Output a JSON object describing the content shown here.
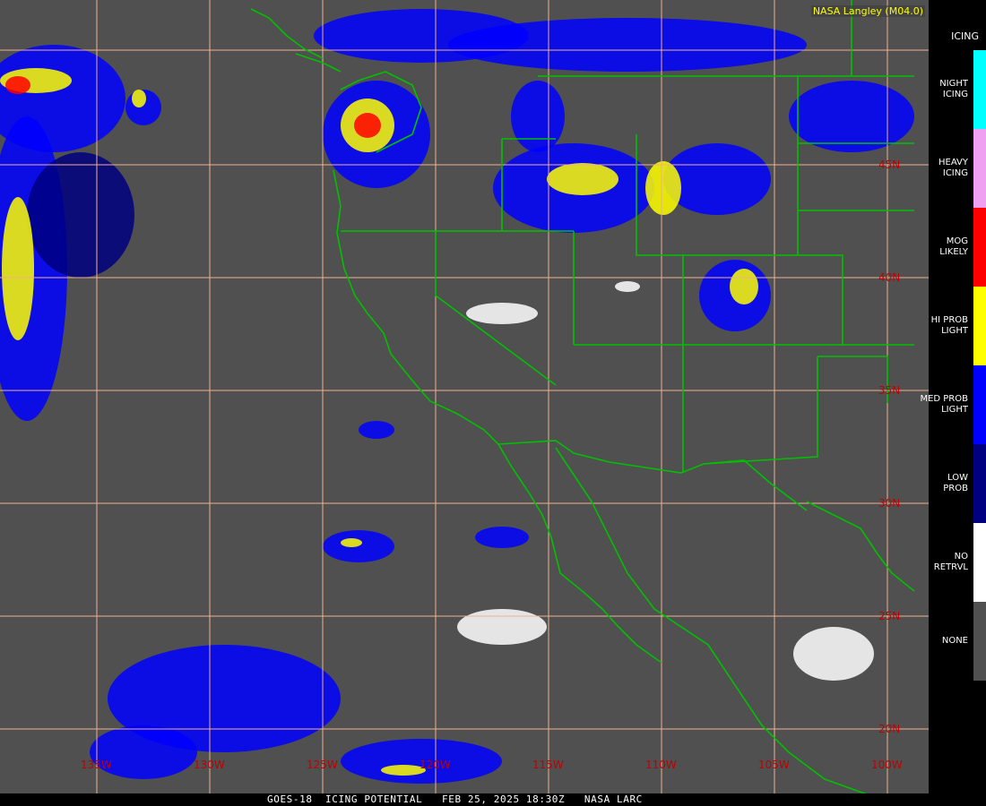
{
  "credit": "NASA Langley (M04.0)",
  "footer": "GOES-18  ICING POTENTIAL   FEB 25, 2025 18:30Z   NASA LARC",
  "legend": {
    "title": "ICING",
    "items": [
      {
        "label1": "NIGHT",
        "label2": "ICING",
        "color": "#00ffff"
      },
      {
        "label1": "HEAVY",
        "label2": "ICING",
        "color": "#f0a0f0"
      },
      {
        "label1": "MOG",
        "label2": "LIKELY",
        "color": "#ff0000"
      },
      {
        "label1": "HI PROB",
        "label2": "LIGHT",
        "color": "#ffff00"
      },
      {
        "label1": "MED PROB",
        "label2": "LIGHT",
        "color": "#0000ff"
      },
      {
        "label1": "LOW",
        "label2": "PROB",
        "color": "#000080"
      },
      {
        "label1": "NO",
        "label2": "RETRVL",
        "color": "#ffffff"
      },
      {
        "label1": "NONE",
        "label2": "",
        "color": "#505050"
      }
    ]
  },
  "map": {
    "lat_labels": [
      "45N",
      "40N",
      "35N",
      "30N",
      "25N",
      "20N"
    ],
    "lon_labels": [
      "135W",
      "130W",
      "125W",
      "120W",
      "115W",
      "110W",
      "105W",
      "100W"
    ],
    "grid_color": "#f0b090",
    "border_color": "#00c000",
    "background": "#505050"
  }
}
